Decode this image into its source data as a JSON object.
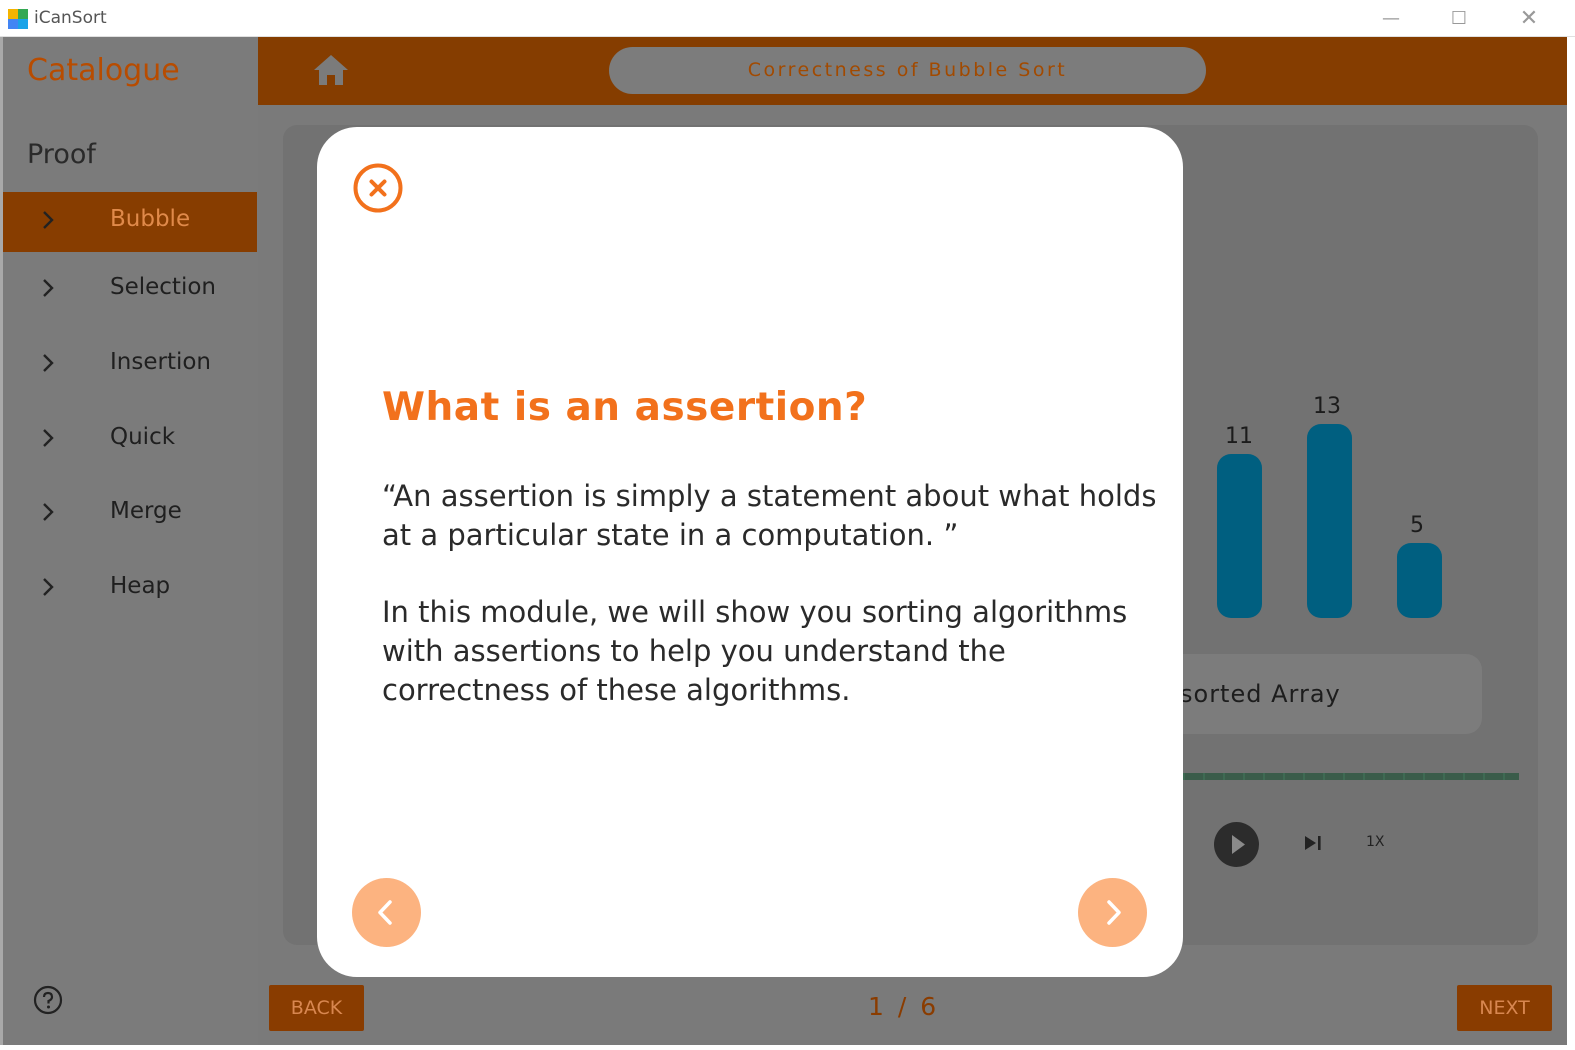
{
  "window": {
    "title": "iCanSort",
    "controls": {
      "minimize": "—",
      "maximize": "☐",
      "close": "✕"
    }
  },
  "sidebar": {
    "heading": "Catalogue",
    "section": "Proof",
    "items": [
      {
        "label": "Bubble",
        "active": true
      },
      {
        "label": "Selection",
        "active": false
      },
      {
        "label": "Insertion",
        "active": false
      },
      {
        "label": "Quick",
        "active": false
      },
      {
        "label": "Merge",
        "active": false
      },
      {
        "label": "Heap",
        "active": false
      }
    ],
    "help_icon": "help-circle-icon"
  },
  "header": {
    "home_icon": "home-icon",
    "title": "Correctness of Bubble Sort"
  },
  "background": {
    "bars": [
      {
        "label": "11",
        "value": 11
      },
      {
        "label": "13",
        "value": 13
      },
      {
        "label": "5",
        "value": 5
      }
    ],
    "sorted_label": "sorted Array",
    "speed": "1X",
    "bar_color": "#005f80"
  },
  "footer": {
    "back": "BACK",
    "page": "1 / 6",
    "next": "NEXT"
  },
  "modal": {
    "heading": "What is an assertion?",
    "paragraph1": "“An assertion is simply a statement about what holds at a particular state in a computation. ”",
    "paragraph2": "In this module, we will show you sorting algorithms with assertions to help you understand the correctness of these algorithms.",
    "accent": "#f2711c"
  },
  "colors": {
    "brand_orange": "#f2711c",
    "header_bg": "#853d00"
  }
}
